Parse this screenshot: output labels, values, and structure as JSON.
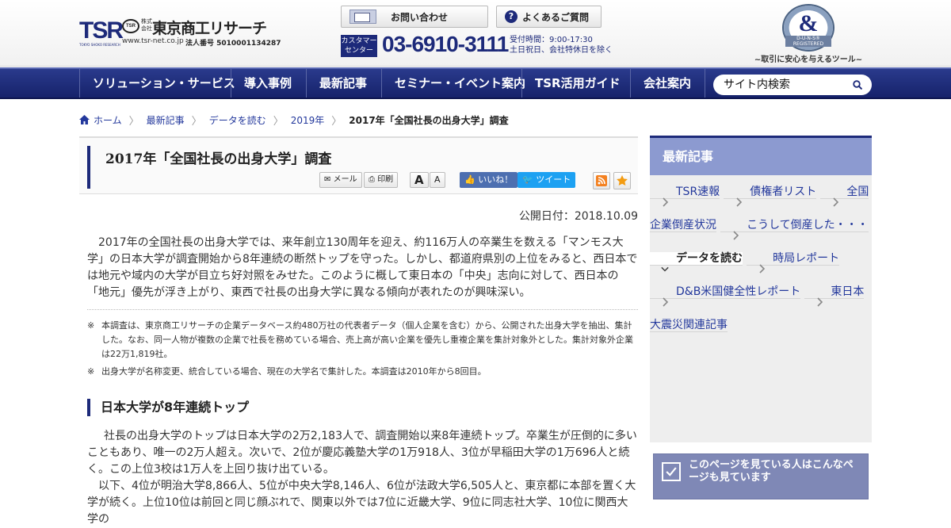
{
  "header": {
    "logo_mark": "TSR",
    "logo_sub": "TOKYO SHOKO RESEARCH",
    "emblem": "TSR",
    "kabushiki": "株式会社",
    "company": "東京商工リサーチ",
    "url": "www.tsr-net.co.jp",
    "corp_no": "法人番号 5010001134287",
    "contact_label": "お問い合わせ",
    "faq_label": "よくあるご質問",
    "cc_badge": "カスタマーセンター",
    "phone": "03-6910-3111",
    "hours_1": "受付時間：9:00-17:30",
    "hours_2": "土日祝日、会社特休日を除く",
    "dnb_reg": "D-U-N-S® REGISTERED",
    "dnb_tag": "~取引に安心を与えるツール~"
  },
  "nav": {
    "items": [
      "ソリューション・サービス",
      "導入事例",
      "最新記事",
      "セミナー・イベント案内",
      "TSR活用ガイド",
      "会社案内"
    ],
    "search_label": "サイト内検索"
  },
  "breadcrumb": [
    "ホーム",
    "最新記事",
    "データを読む",
    "2019年",
    "2017年「全国社長の出身大学」調査"
  ],
  "article": {
    "title": "2017年「全国社長の出身大学」調査",
    "mail_label": "メール",
    "print_label": "印刷",
    "font_large": "A",
    "font_small": "A",
    "like_label": "いいね！",
    "tweet_label": "ツイート",
    "pub_date": "公開日付：2018.10.09",
    "lead": "2017年の全国社長の出身大学では、来年創立130周年を迎え、約116万人の卒業生を数える「マンモス大学」の日本大学が調査開始から8年連続の断然トップを守った。しかし、都道府県別の上位をみると、西日本では地元や域内の大学が目立ち好対照をみせた。このように概して東日本の「中央」志向に対して、西日本の「地元」優先が浮き上がり、東西で社長の出身大学に異なる傾向が表れたのが興味深い。",
    "note_1": "本調査は、東京商工リサーチの企業データベース約480万社の代表者データ（個人企業を含む）から、公開された出身大学を抽出、集計した。なお、同一人物が複数の企業で社長を務めている場合、売上高が高い企業を優先し重複企業を集計対象外とした。集計対象外企業は22万1,819社。",
    "note_2": "出身大学が名称変更、統合している場合、現在の大学名で集計した。本調査は2010年から8回目。",
    "section_title": "日本大学が8年連続トップ",
    "body_1": "社長の出身大学のトップは日本大学の2万2,183人で、調査開始以来8年連続トップ。卒業生が圧倒的に多いこともあり、唯一の2万人超え。次いで、2位が慶応義塾大学の1万918人、3位が早稲田大学の1万696人と続く。この上位3校は1万人を上回り抜け出ている。",
    "body_2": "以下、4位が明治大学8,866人、5位が中央大学8,146人、6位が法政大学6,505人と、東京都に本部を置く大学が続く。上位10位は前回と同じ顔ぶれで、関東以外では7位に近畿大学、9位に同志社大学、10位に関西大学の"
  },
  "sidebar": {
    "title": "最新記事",
    "items": [
      "TSR速報",
      "債権者リスト",
      "全国企業倒産状況",
      "こうして倒産した・・・",
      "データを読む",
      "時局レポート",
      "D&B米国健全性レポート",
      "東日本大震災関連記事"
    ],
    "related_title": "このページを見ている人はこんなページも見ています"
  },
  "colors": {
    "navy": "#1d2a7a",
    "sidebar_head": "#8c9ad0",
    "link": "#23389c"
  }
}
